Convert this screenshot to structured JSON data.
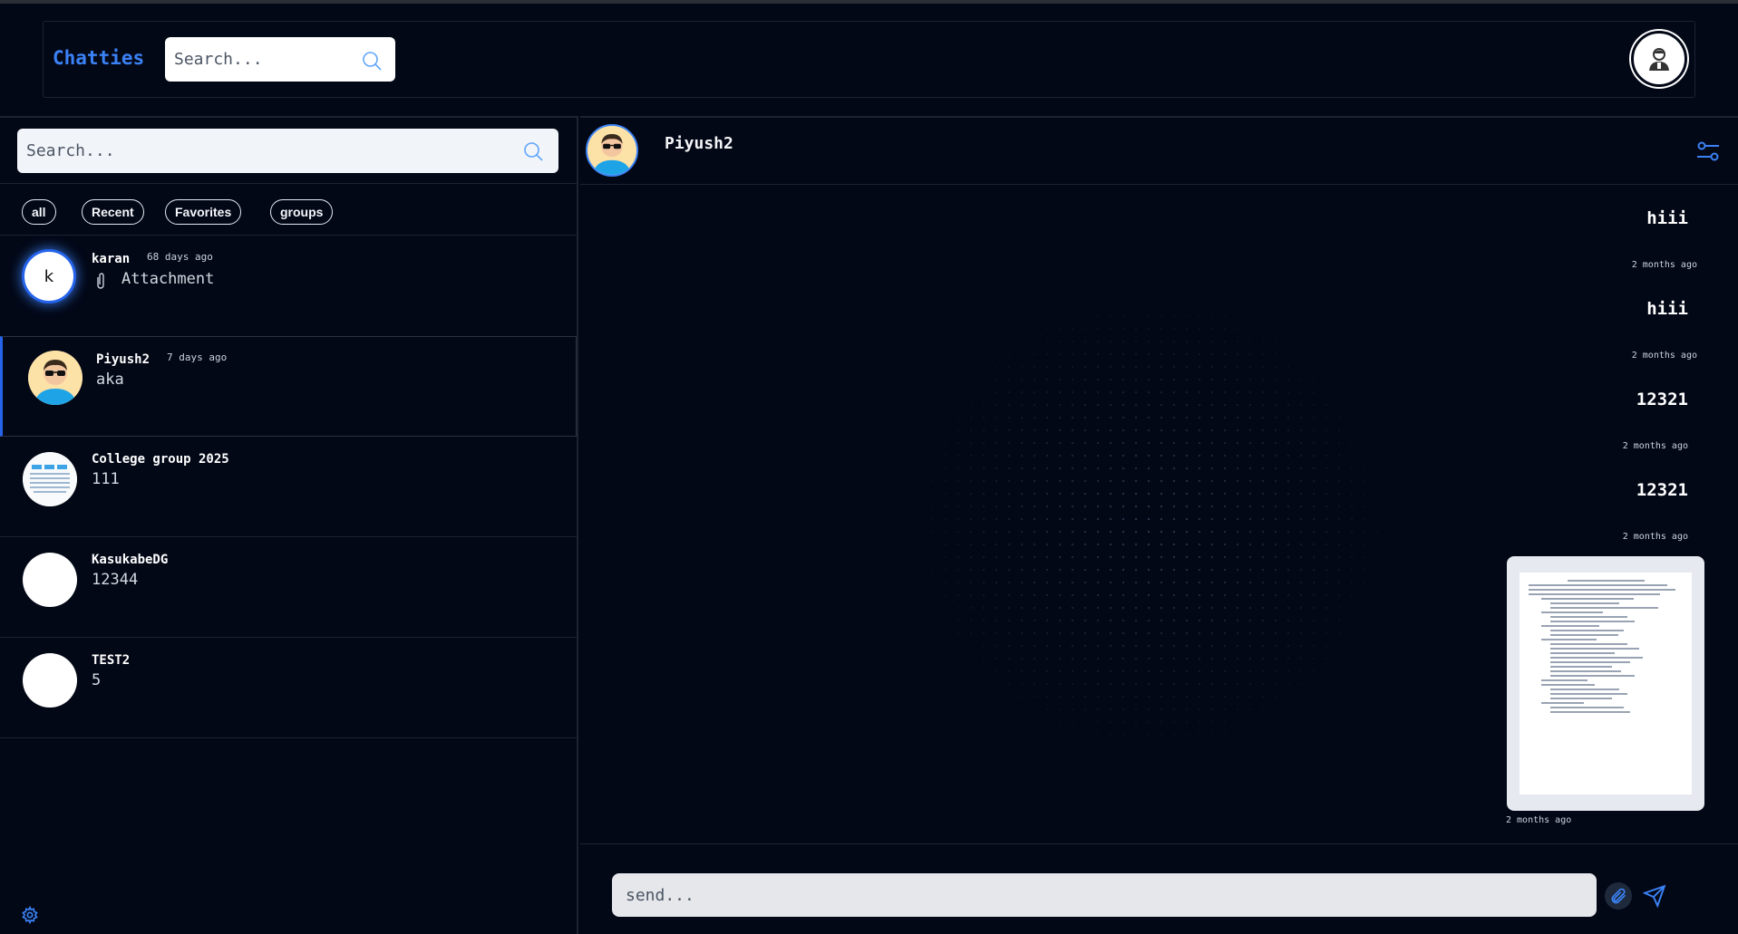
{
  "app": {
    "brand": "Chatties"
  },
  "header": {
    "search_placeholder": "Search...",
    "profile_icon": "user-avatar-icon"
  },
  "sidebar": {
    "search_placeholder": "Search...",
    "filters": [
      "all",
      "Recent",
      "Favorites",
      "groups"
    ],
    "chats": [
      {
        "name": "karan",
        "time": "68 days ago",
        "last": "Attachment",
        "avatar": "k",
        "has_attachment_icon": true
      },
      {
        "name": "Piyush2",
        "time": "7 days ago",
        "last": "aka",
        "active": true
      },
      {
        "name": "College group 2025",
        "time": "",
        "last": "111"
      },
      {
        "name": "KasukabeDG",
        "time": "",
        "last": "12344"
      },
      {
        "name": "TEST2",
        "time": "",
        "last": "5"
      }
    ],
    "settings_icon": "gear-icon"
  },
  "chat": {
    "title": "Piyush2",
    "messages": [
      {
        "text": "hiii",
        "time": "2 months ago"
      },
      {
        "text": "hiii",
        "time": "2 months ago"
      },
      {
        "text": "12321",
        "time": "2 months ago"
      },
      {
        "text": "12321",
        "time": "2 months ago"
      }
    ],
    "attachment_time": "2 months ago",
    "composer_placeholder": "send..."
  },
  "colors": {
    "background": "#030817",
    "accent": "#3b82f6",
    "border": "#1c2333"
  }
}
